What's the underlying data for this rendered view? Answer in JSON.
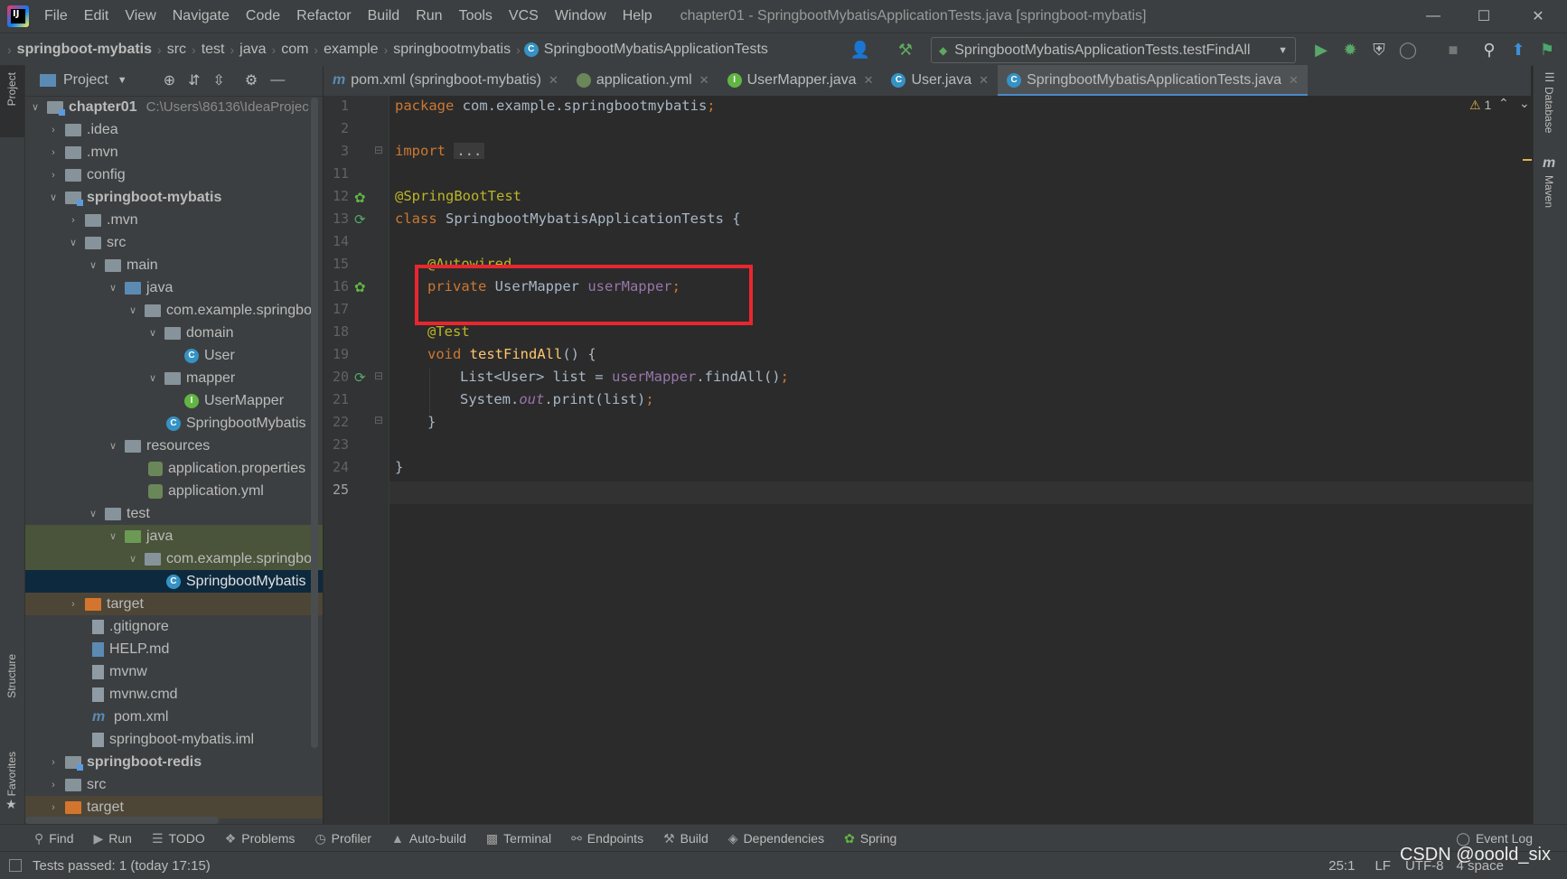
{
  "window": {
    "title": "chapter01 - SpringbootMybatisApplicationTests.java [springboot-mybatis]",
    "menu": [
      "File",
      "Edit",
      "View",
      "Navigate",
      "Code",
      "Refactor",
      "Build",
      "Run",
      "Tools",
      "VCS",
      "Window",
      "Help"
    ]
  },
  "breadcrumb": [
    "springboot-mybatis",
    "src",
    "test",
    "java",
    "com",
    "example",
    "springbootmybatis",
    "SpringbootMybatisApplicationTests"
  ],
  "run_config": "SpringbootMybatisApplicationTests.testFindAll",
  "project_panel": {
    "title": "Project",
    "tree": [
      {
        "label": "chapter01",
        "path": "C:\\Users\\86136\\IdeaProjec",
        "bold": true
      },
      {
        "label": ".idea"
      },
      {
        "label": ".mvn"
      },
      {
        "label": "config"
      },
      {
        "label": "springboot-mybatis",
        "bold": true
      },
      {
        "label": ".mvn"
      },
      {
        "label": "src"
      },
      {
        "label": "main"
      },
      {
        "label": "java"
      },
      {
        "label": "com.example.springbo"
      },
      {
        "label": "domain"
      },
      {
        "label": "User"
      },
      {
        "label": "mapper"
      },
      {
        "label": "UserMapper"
      },
      {
        "label": "SpringbootMybatis"
      },
      {
        "label": "resources"
      },
      {
        "label": "application.properties"
      },
      {
        "label": "application.yml"
      },
      {
        "label": "test"
      },
      {
        "label": "java"
      },
      {
        "label": "com.example.springbo"
      },
      {
        "label": "SpringbootMybatis"
      },
      {
        "label": "target"
      },
      {
        "label": ".gitignore"
      },
      {
        "label": "HELP.md"
      },
      {
        "label": "mvnw"
      },
      {
        "label": "mvnw.cmd"
      },
      {
        "label": "pom.xml"
      },
      {
        "label": "springboot-mybatis.iml"
      },
      {
        "label": "springboot-redis",
        "bold": true
      },
      {
        "label": "src"
      },
      {
        "label": "target"
      }
    ]
  },
  "tabs": [
    {
      "label": "pom.xml (springboot-mybatis)",
      "icon": "m"
    },
    {
      "label": "application.yml",
      "icon": "yml"
    },
    {
      "label": "UserMapper.java",
      "icon": "I"
    },
    {
      "label": "User.java",
      "icon": "C"
    },
    {
      "label": "SpringbootMybatisApplicationTests.java",
      "icon": "C",
      "active": true
    }
  ],
  "line_numbers": [
    "1",
    "2",
    "3",
    "11",
    "12",
    "13",
    "14",
    "15",
    "16",
    "17",
    "18",
    "19",
    "20",
    "21",
    "22",
    "23",
    "24",
    "25"
  ],
  "code": {
    "l1_kw": "package",
    "l1_rest": " com.example.springbootmybatis",
    "l3_kw": "import",
    "l3_fold": "...",
    "l12": "@SpringBootTest",
    "l13_kw": "class",
    "l13_rest": " SpringbootMybatisApplicationTests {",
    "l15": "@Autowired",
    "l16_kw": "private",
    "l16_type": " UserMapper ",
    "l16_field": "userMapper",
    "l18": "@Test",
    "l19_kw": "void",
    "l19_fn": "testFindAll",
    "l19_rest": "() {",
    "l20_a": "List<User> list = ",
    "l20_field": "userMapper",
    "l20_b": ".findAll()",
    "l21_a": "System.",
    "l21_out": "out",
    "l21_b": ".print(list)",
    "l22": "}",
    "l24": "}",
    "semicolon": ";"
  },
  "inspection": {
    "warnings": "1"
  },
  "right_stripe": [
    "Database",
    "Maven"
  ],
  "left_stripe": [
    "Project",
    "Structure",
    "Favorites"
  ],
  "bottom_tools": [
    "Find",
    "Run",
    "TODO",
    "Problems",
    "Profiler",
    "Auto-build",
    "Terminal",
    "Endpoints",
    "Build",
    "Dependencies",
    "Spring"
  ],
  "event_log": "Event Log",
  "status": {
    "message": "Tests passed: 1 (today 17:15)",
    "position": "25:1",
    "line_sep": "LF",
    "encoding": "UTF-8",
    "indent": "4 space"
  },
  "watermark": "CSDN @ooold_six",
  "colors": {
    "keyword": "#cc7832",
    "annotation": "#bbb529",
    "field": "#9876aa",
    "method": "#ffc66d",
    "highlight_box": "#e8262f"
  }
}
